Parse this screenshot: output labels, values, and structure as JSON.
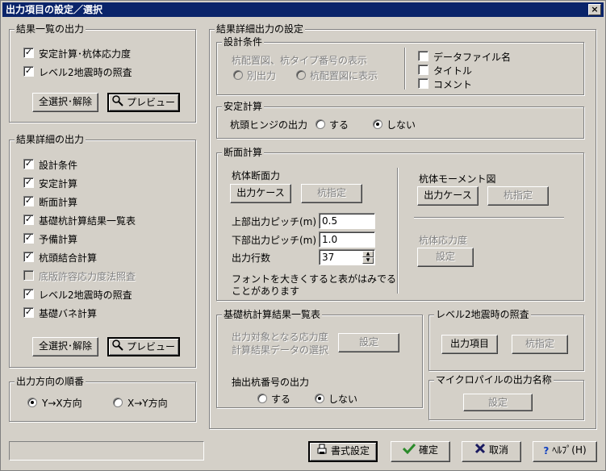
{
  "window": {
    "title": "出力項目の設定／選択",
    "close_label": "×"
  },
  "summary": {
    "title": "結果一覧の出力",
    "items": [
      {
        "label": "安定計算･杭体応力度",
        "checked": true
      },
      {
        "label": "レベル2地震時の照査",
        "checked": true
      }
    ],
    "select_all_label": "全選択･解除",
    "preview_label": "プレビュー"
  },
  "detail": {
    "title": "結果詳細の出力",
    "items": [
      {
        "label": "設計条件",
        "checked": true
      },
      {
        "label": "安定計算",
        "checked": true
      },
      {
        "label": "断面計算",
        "checked": true
      },
      {
        "label": "基礎杭計算結果一覧表",
        "checked": true
      },
      {
        "label": "予備計算",
        "checked": true
      },
      {
        "label": "杭頭結合計算",
        "checked": true
      },
      {
        "label": "底版許容応力度法照査",
        "checked": false,
        "disabled": true
      },
      {
        "label": "レベル2地震時の照査",
        "checked": true
      },
      {
        "label": "基礎バネ計算",
        "checked": true
      }
    ],
    "select_all_label": "全選択･解除",
    "preview_label": "プレビュー"
  },
  "direction": {
    "title": "出力方向の順番",
    "options": [
      {
        "label": "Y→X方向",
        "selected": true
      },
      {
        "label": "X→Y方向",
        "selected": false
      }
    ]
  },
  "detail_settings": {
    "title": "結果詳細出力の設定",
    "design_conditions": {
      "title": "設計条件",
      "pile_display_label": "杭配置図、杭タイプ番号の表示",
      "radio_separate": "別出力",
      "radio_in_layout": "杭配置図に表示",
      "checks": [
        {
          "label": "データファイル名",
          "checked": false
        },
        {
          "label": "タイトル",
          "checked": false
        },
        {
          "label": "コメント",
          "checked": false
        }
      ]
    },
    "stability": {
      "title": "安定計算",
      "hinge_label": "杭頭ヒンジの出力",
      "option_yes": "する",
      "option_no": "しない",
      "selected": "しない"
    },
    "section": {
      "title": "断面計算",
      "pile_section_force": "杭体断面力",
      "output_case_label": "出力ケース",
      "pile_specify_label": "杭指定",
      "pile_moment_diagram": "杭体モーメント図",
      "moment_output_case_label": "出力ケース",
      "moment_pile_specify_label": "杭指定",
      "upper_pitch_label": "上部出力ピッチ(m)",
      "upper_pitch_value": "0.5",
      "lower_pitch_label": "下部出力ピッチ(m)",
      "lower_pitch_value": "1.0",
      "rows_label": "出力行数",
      "rows_value": "37",
      "font_note_line1": "フォントを大きくすると表がはみでる",
      "font_note_line2": "ことがあります",
      "stress_label": "杭体応力度",
      "stress_setting_label": "設定"
    },
    "pile_table": {
      "title": "基礎杭計算結果一覧表",
      "stress_select_line1": "出力対象となる応力度",
      "stress_select_line2": "計算結果データの選択",
      "setting_label": "設定",
      "extract_label": "抽出杭番号の出力",
      "option_yes": "する",
      "option_no": "しない",
      "selected": "しない"
    },
    "level2": {
      "title": "レベル2地震時の照査",
      "output_items_label": "出力項目",
      "pile_specify_label": "杭指定"
    },
    "micropile": {
      "title": "マイクロパイルの出力名称",
      "setting_label": "設定"
    }
  },
  "footer": {
    "format_label": "書式設定",
    "ok_label": "確定",
    "cancel_label": "取消",
    "help_label": "ﾍﾙﾌﾟ(H)"
  },
  "colors": {
    "title_bar": "#0a246a",
    "face": "#d4d0c8",
    "ok_check": "#2a8a2a",
    "cancel_x": "#1a1a60",
    "help_q": "#1040c0"
  }
}
